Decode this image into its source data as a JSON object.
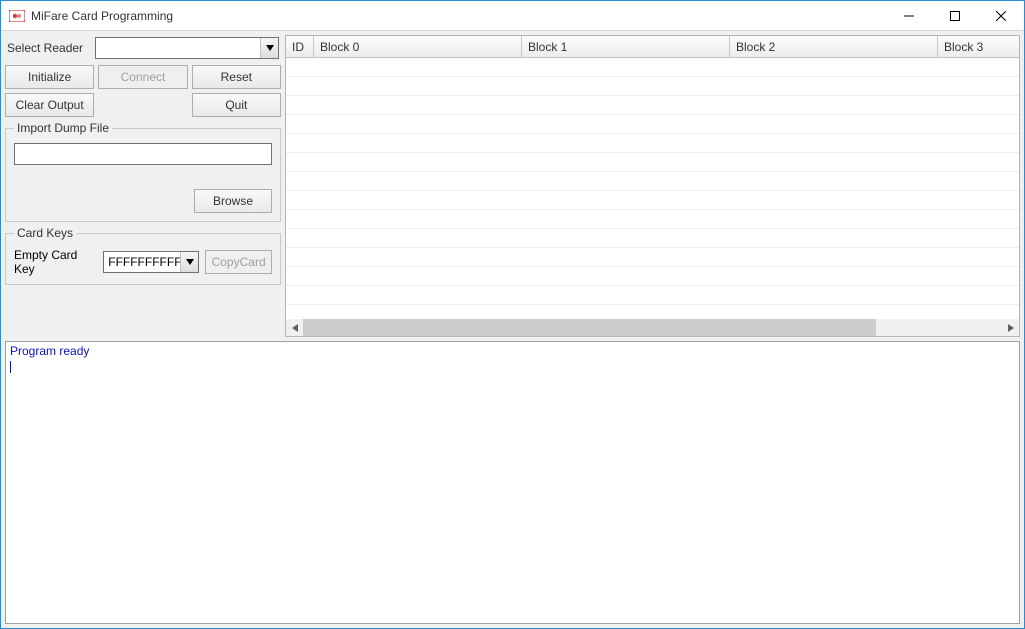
{
  "window": {
    "title": "MiFare Card Programming"
  },
  "reader": {
    "label": "Select Reader",
    "value": ""
  },
  "buttons": {
    "initialize": "Initialize",
    "connect": "Connect",
    "reset": "Reset",
    "clear_output": "Clear Output",
    "quit": "Quit",
    "browse": "Browse",
    "copycard": "CopyCard"
  },
  "import_dump": {
    "legend": "Import Dump File",
    "path": ""
  },
  "card_keys": {
    "legend": "Card Keys",
    "empty_label": "Empty Card Key",
    "value": "FFFFFFFFFFFF"
  },
  "grid": {
    "columns": [
      "ID",
      "Block 0",
      "Block 1",
      "Block 2",
      "Block 3"
    ]
  },
  "output": {
    "text": "Program ready"
  }
}
